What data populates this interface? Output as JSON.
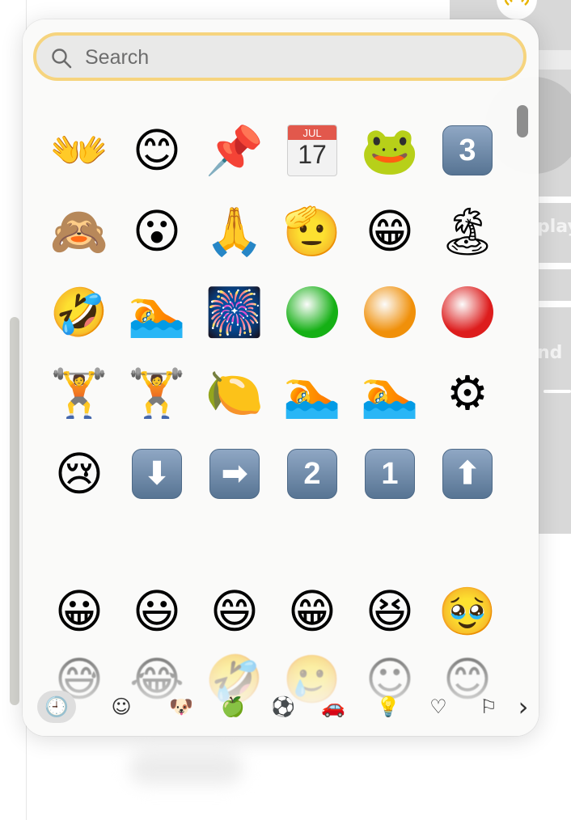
{
  "search": {
    "placeholder": "Search",
    "value": ""
  },
  "background": {
    "label_play": "play",
    "label_end": "nd"
  },
  "frequently_used": [
    {
      "char": "👐",
      "name": "open-hands"
    },
    {
      "char": "😊",
      "name": "smiling-face"
    },
    {
      "char": "📌",
      "name": "pushpin"
    },
    {
      "char": "📅",
      "name": "calendar"
    },
    {
      "char": "🐸",
      "name": "frog"
    },
    {
      "char": "3",
      "name": "keycap-3"
    },
    {
      "char": "🙈",
      "name": "face-covering-eyes"
    },
    {
      "char": "😮",
      "name": "face-open-mouth"
    },
    {
      "char": "🙏",
      "name": "folded-hands"
    },
    {
      "char": "🫡",
      "name": "saluting-face"
    },
    {
      "char": "😁",
      "name": "grinning-face"
    },
    {
      "char": "🏝",
      "name": "island"
    },
    {
      "char": "🤣",
      "name": "rofl-face"
    },
    {
      "char": "🏊",
      "name": "person-swimming"
    },
    {
      "char": "🎆",
      "name": "fireworks"
    },
    {
      "char": "🟢",
      "name": "green-circle"
    },
    {
      "char": "🟠",
      "name": "orange-circle"
    },
    {
      "char": "🔴",
      "name": "red-circle"
    },
    {
      "char": "🏋",
      "name": "weightlifter"
    },
    {
      "char": "🏋",
      "name": "weightlifter-2"
    },
    {
      "char": "🍋",
      "name": "lemon"
    },
    {
      "char": "🏊",
      "name": "woman-swimming"
    },
    {
      "char": "🏊",
      "name": "man-swimming"
    },
    {
      "char": "⚙",
      "name": "gear"
    },
    {
      "char": "😢",
      "name": "crying-face"
    },
    {
      "char": "⬇",
      "name": "down-arrow"
    },
    {
      "char": "➡",
      "name": "right-arrow"
    },
    {
      "char": "2",
      "name": "keycap-2"
    },
    {
      "char": "1",
      "name": "keycap-1"
    },
    {
      "char": "⬆",
      "name": "up-arrow"
    }
  ],
  "calendar": {
    "month": "JUL",
    "day": "17"
  },
  "smileys": [
    {
      "char": "😀",
      "name": "grinning"
    },
    {
      "char": "😃",
      "name": "grinning-big-eyes"
    },
    {
      "char": "😄",
      "name": "grinning-smiling-eyes"
    },
    {
      "char": "😁",
      "name": "beaming"
    },
    {
      "char": "😆",
      "name": "squinting"
    },
    {
      "char": "🥹",
      "name": "holding-back-tears"
    },
    {
      "char": "😅",
      "name": "sweat-smile"
    },
    {
      "char": "😂",
      "name": "tears-of-joy"
    },
    {
      "char": "🤣",
      "name": "rolling-laughing"
    },
    {
      "char": "🥲",
      "name": "smile-with-tear"
    },
    {
      "char": "☺",
      "name": "smiling"
    },
    {
      "char": "😊",
      "name": "blush"
    }
  ],
  "categories": [
    {
      "name": "recent",
      "glyph": "🕘"
    },
    {
      "name": "smileys",
      "glyph": "☺"
    },
    {
      "name": "animals",
      "glyph": "🐶"
    },
    {
      "name": "food",
      "glyph": "🍏"
    },
    {
      "name": "activity",
      "glyph": "⚽"
    },
    {
      "name": "travel",
      "glyph": "🚗"
    },
    {
      "name": "objects",
      "glyph": "💡"
    },
    {
      "name": "symbols",
      "glyph": "♡"
    },
    {
      "name": "flags",
      "glyph": "⚐"
    },
    {
      "name": "more",
      "glyph": "›"
    }
  ],
  "colors": {
    "search_border": "#f6d47e",
    "keycap": "#6a87a8",
    "green": "#15b015",
    "orange": "#f0900a",
    "red": "#dd1d1d"
  }
}
